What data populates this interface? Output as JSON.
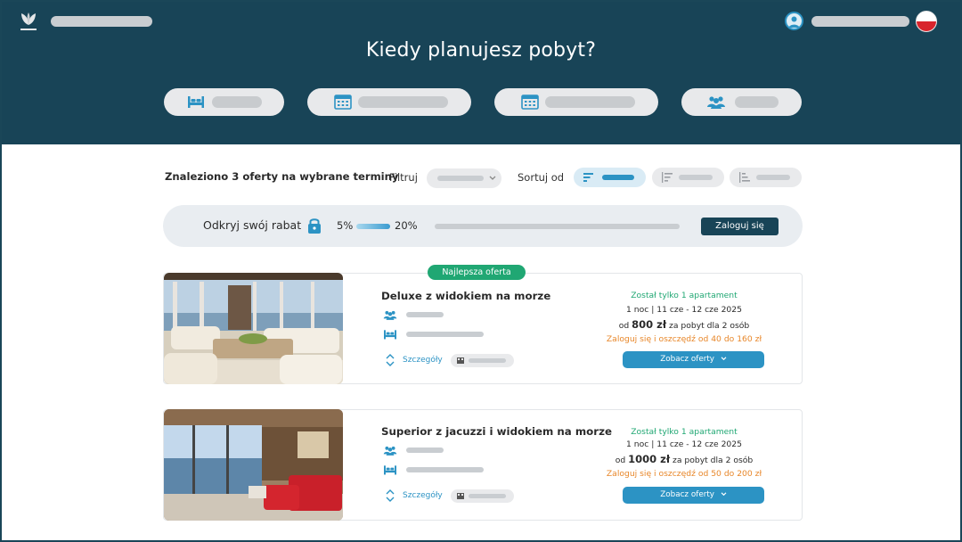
{
  "header": {
    "title": "Kiedy planujesz pobyt?",
    "language": "pl",
    "brand_color": "#184457",
    "accent_color": "#2c93c4",
    "search_fields": [
      {
        "icon": "bed-icon"
      },
      {
        "icon": "calendar-icon"
      },
      {
        "icon": "calendar-icon"
      },
      {
        "icon": "guests-icon"
      }
    ]
  },
  "results": {
    "count_text": "Znaleziono 3 oferty na wybrane terminy",
    "filter_label": "Filtruj",
    "sort_label": "Sortuj od"
  },
  "discount": {
    "label": "Odkryj swój rabat",
    "min_pct": "5%",
    "max_pct": "20%",
    "progress_fraction": 0,
    "login_label": "Zaloguj się"
  },
  "offers": [
    {
      "badge": "Najlepsza oferta",
      "name": "Deluxe z widokiem na morze",
      "availability": "Został tylko 1 apartament",
      "dates": "1 noc | 11 cze - 12 cze 2025",
      "price_prefix": "od",
      "price": "800 zł",
      "price_suffix": "za pobyt dla 2 osób",
      "savings": "Zaloguj się i oszczędź od 40 do 160 zł",
      "details_label": "Szczegóły",
      "button_label": "Zobacz oferty"
    },
    {
      "name": "Superior z jacuzzi i widokiem na morze",
      "availability": "Został tylko 1 apartament",
      "dates": "1 noc | 11 cze - 12 cze 2025",
      "price_prefix": "od",
      "price": "1000 zł",
      "price_suffix": "za pobyt dla 2 osób",
      "savings": "Zaloguj się i oszczędź od 50 do 200 zł",
      "details_label": "Szczegóły",
      "button_label": "Zobacz oferty"
    }
  ]
}
